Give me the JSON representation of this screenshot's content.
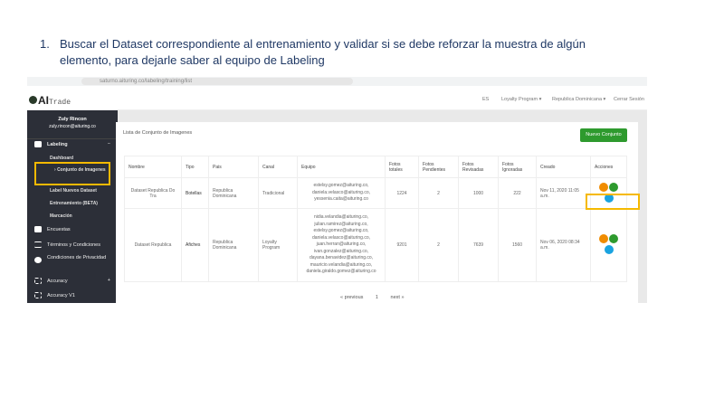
{
  "instruction": {
    "number": "1.",
    "text": "Buscar el Dataset correspondiente al entrenamiento y validar si se debe reforzar la muestra de algún elemento, para dejarle saber al equipo de Labeling"
  },
  "browser": {
    "url": "saturno.aituring.co/labeling/training/list"
  },
  "header": {
    "logo": "AI",
    "logo_suffix": "Trade",
    "lang": "ES",
    "program": "Loyalty Program ▾",
    "country": "Republica Dominicana ▾",
    "logout": "Cerrar Sesión"
  },
  "sidebar": {
    "user_name": "Zuly Rincon",
    "user_email": "zuly.rincon@aituring.co",
    "labeling": "Labeling",
    "labeling_toggle": "−",
    "sub": [
      "Dashboard",
      "Conjunto de Imagenes",
      "Label Nuevos Dataset",
      "Entrenamiento (BETA)",
      "Marcación"
    ],
    "items": [
      "Encuestas",
      "Términos y Condiciones",
      "Condiciones de Privacidad",
      "Accuracy",
      "Accuracy V1"
    ],
    "accuracy_toggle": "+"
  },
  "card": {
    "title": "Lista de Conjunto de Imagenes",
    "new_button": "Nuevo Conjunto"
  },
  "table": {
    "headers": [
      "Nombre",
      "Tipo",
      "Pais",
      "Canal",
      "Equipo",
      "Fotos totales",
      "Fotos Pendientes",
      "Fotos Revisadas",
      "Fotos Ignoradas",
      "Creado",
      "Acciones"
    ],
    "rows": [
      {
        "nombre": "Dataset Republica Do Tra",
        "tipo": "Botellas",
        "pais": "Republica Dominicana",
        "canal": "Tradicional",
        "equipo": "estelsy.gomez@aituring.co, daniela.velasco@aituring.co, yessenia.caita@aituring.co",
        "totales": "1224",
        "pendientes": "2",
        "revisadas": "1000",
        "ignoradas": "222",
        "creado": "Nov 11, 2020 11:05 a.m."
      },
      {
        "nombre": "Dataset Republica",
        "tipo": "Afiches",
        "pais": "Republica Dominicana",
        "canal": "Loyalty Program",
        "equipo": "nidia.velandia@aituring.co, julian.ramirez@aituring.co, estelsy.gomez@aituring.co, daniela.velasco@aituring.co, juan.herran@aituring.co, ivan.gonzalez@aituring.co, dayana.benavidez@aituring.co, mauricio.velandia@aituring.co, daniela.giraldo.gomez@aituring.co",
        "totales": "9201",
        "pendientes": "2",
        "revisadas": "7639",
        "ignoradas": "1560",
        "creado": "Nov 06, 2020 08:34 a.m."
      }
    ]
  },
  "pager": {
    "prev": "« previous",
    "page": "1",
    "next": "next »"
  },
  "colors": {
    "sidebar": "#2c2f38",
    "primary": "#2e9a2e",
    "edit": "#f08c00",
    "images": "#2e9a2e",
    "view": "#1aa3e0",
    "highlight": "#f5b900"
  }
}
